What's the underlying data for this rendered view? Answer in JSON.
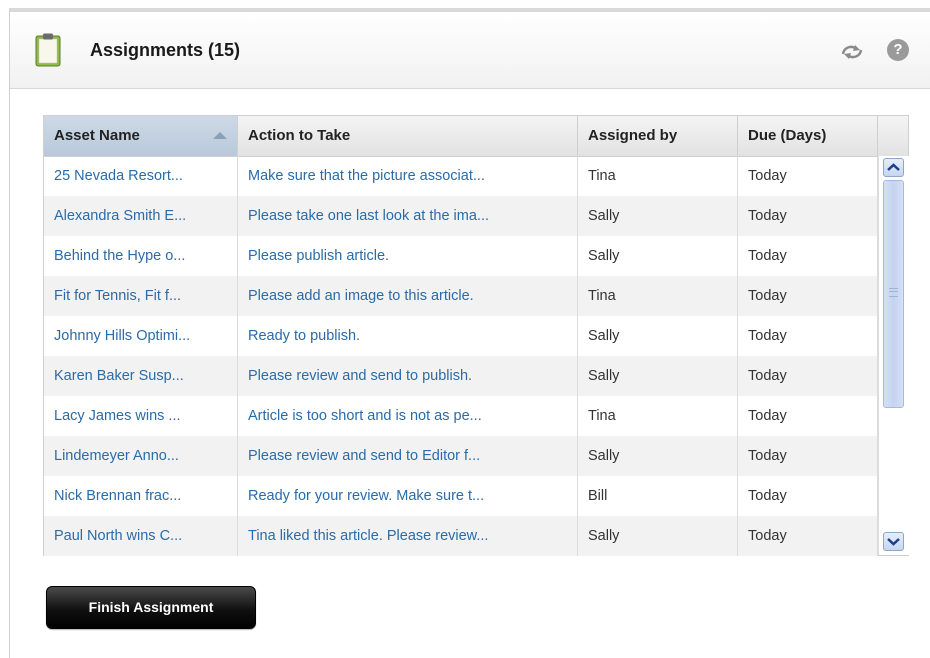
{
  "header": {
    "title": "Assignments (15)",
    "icons": {
      "left": "clipboard-icon",
      "refresh": "refresh-icon",
      "help": "help-icon"
    },
    "help_glyph": "?"
  },
  "table": {
    "sorted_column": "Asset Name",
    "sort_direction": "ascending",
    "columns": [
      "Asset Name",
      "Action to Take",
      "Assigned by",
      "Due (Days)"
    ],
    "rows": [
      [
        "25 Nevada Resort...",
        "Make sure that the picture associat...",
        "Tina",
        "Today"
      ],
      [
        "Alexandra Smith E...",
        "Please take one last look at the ima...",
        "Sally",
        "Today"
      ],
      [
        "Behind the Hype o...",
        "Please publish article.",
        "Sally",
        "Today"
      ],
      [
        "Fit for Tennis, Fit f...",
        "Please add an image to this article.",
        "Tina",
        "Today"
      ],
      [
        "Johnny Hills Optimi...",
        "Ready to publish.",
        "Sally",
        "Today"
      ],
      [
        "Karen Baker Susp...",
        "Please review and send to publish.",
        "Sally",
        "Today"
      ],
      [
        "Lacy James wins ...",
        "Article is too short and is not as pe...",
        "Tina",
        "Today"
      ],
      [
        "Lindemeyer Anno...",
        "Please review and send to Editor f...",
        "Sally",
        "Today"
      ],
      [
        "Nick Brennan frac...",
        "Ready for your review. Make sure t...",
        "Bill",
        "Today"
      ],
      [
        "Paul North wins C...",
        "Tina liked this article. Please review...",
        "Sally",
        "Today"
      ]
    ]
  },
  "actions": {
    "finish_label": "Finish Assignment"
  },
  "colors": {
    "link": "#2a6ba8",
    "button": "#111111",
    "header_sorted": "#c4d2e2"
  }
}
